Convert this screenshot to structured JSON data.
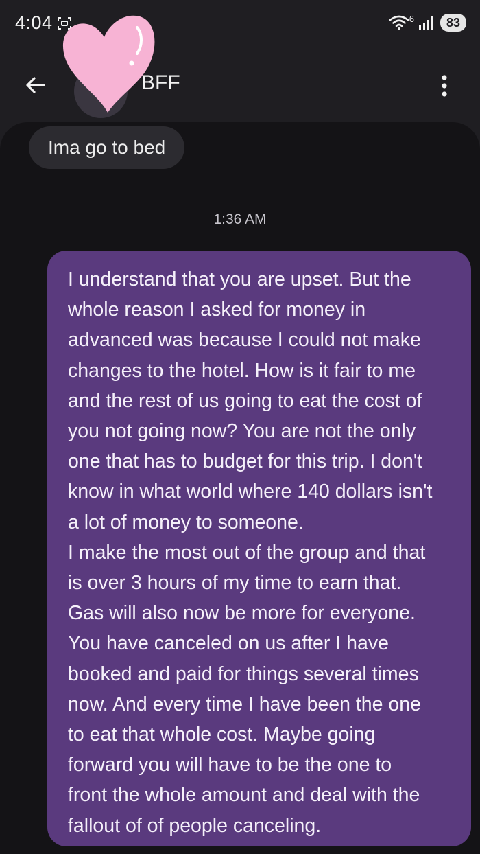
{
  "status_bar": {
    "time": "4:04",
    "network_label": "6",
    "battery_level": "83"
  },
  "app_bar": {
    "contact_name": "BFF"
  },
  "messages": {
    "incoming_1": "Ima go to bed",
    "timestamp": "1:36 AM",
    "outgoing_lines": [
      "I understand that you are upset. But the",
      "whole reason I asked for money in",
      "advanced was because I could not make",
      "changes to the hotel. How is it fair to me",
      "and the rest of us going to eat the cost of",
      "you not going now? You are not the only",
      "one that has to budget for this trip. I don't",
      "know in what world where 140 dollars isn't",
      "a lot of money to someone.",
      "I make the most out of the group and that",
      "is over 3 hours of my time to earn that.",
      "Gas will also now be more for everyone.",
      "You have canceled on us after I have",
      "booked and paid for things several times",
      "now. And every time I have been the one",
      "to eat that whole cost. Maybe going",
      "forward you will have to be the one to",
      "front the whole amount and deal with the",
      "fallout of of people canceling."
    ]
  },
  "icons": {
    "screenshot": "screenshot-icon",
    "wifi": "wifi-icon",
    "signal": "signal-icon",
    "back": "arrow-left-icon",
    "more": "more-vertical-icon",
    "sticker": "heart-sticker"
  },
  "colors": {
    "background": "#1f1e22",
    "conversation_bg": "#141316",
    "incoming_bubble": "#2c2b30",
    "outgoing_bubble": "#5a3a7e",
    "heart": "#f7b3d4"
  }
}
